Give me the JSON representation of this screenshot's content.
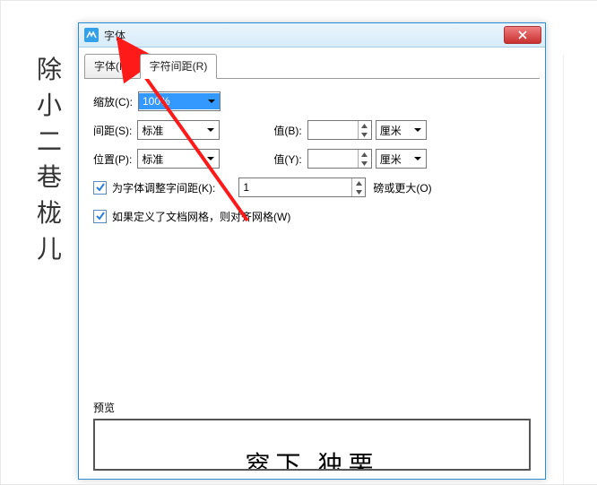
{
  "background_text": [
    "除",
    "小",
    "二",
    "巷",
    "栊",
    "儿"
  ],
  "window": {
    "title": "字体",
    "tabs": [
      {
        "label": "字体(N)",
        "active": false
      },
      {
        "label": "字符间距(R)",
        "active": true
      }
    ],
    "close_tooltip": "关闭"
  },
  "fields": {
    "scale": {
      "label": "缩放(C):",
      "value": "100%"
    },
    "spacing": {
      "label": "间距(S):",
      "value": "标准"
    },
    "position": {
      "label": "位置(P):",
      "value": "标准"
    },
    "value_b": {
      "label": "值(B):",
      "value": "",
      "unit_label": "厘米",
      "unit_value": ""
    },
    "value_y": {
      "label": "值(Y):",
      "value": "",
      "unit_label": "厘米",
      "unit_value": ""
    },
    "kerning": {
      "checked": true,
      "label": "为字体调整字间距(K):",
      "value": "1",
      "suffix": "磅或更大(O)"
    },
    "snapgrid": {
      "checked": true,
      "label": "如果定义了文档网格，则对齐网格(W)"
    }
  },
  "preview": {
    "label": "预览",
    "sample": "窣下   独栗"
  }
}
